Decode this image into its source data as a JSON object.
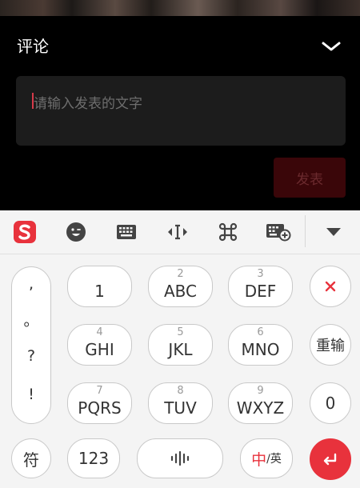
{
  "panel": {
    "title": "评论",
    "placeholder": "请输入发表的文字",
    "publish_label": "发表"
  },
  "keyboard": {
    "punctuation": [
      ",",
      "。",
      "?",
      "!"
    ],
    "keys": [
      {
        "num": "",
        "label": "1"
      },
      {
        "num": "2",
        "label": "ABC"
      },
      {
        "num": "3",
        "label": "DEF"
      },
      {
        "num": "4",
        "label": "GHI"
      },
      {
        "num": "5",
        "label": "JKL"
      },
      {
        "num": "6",
        "label": "MNO"
      },
      {
        "num": "7",
        "label": "PQRS"
      },
      {
        "num": "8",
        "label": "TUV"
      },
      {
        "num": "9",
        "label": "WXYZ"
      }
    ],
    "reinput_label": "重输",
    "zero_label": "0",
    "symbol_label": "符",
    "numeric_label": "123",
    "lang_cn": "中",
    "lang_sep": "/英"
  },
  "icons": {
    "toolbar": [
      "sogou-logo-icon",
      "emoji-icon",
      "keyboard-icon",
      "cursor-move-icon",
      "command-icon",
      "clipboard-keyboard-icon",
      "hide-keyboard-icon"
    ],
    "delete": "delete-icon",
    "voice": "voice-icon",
    "enter": "enter-icon"
  },
  "colors": {
    "accent": "#e8323c",
    "publish_disabled": "#3a0609"
  }
}
